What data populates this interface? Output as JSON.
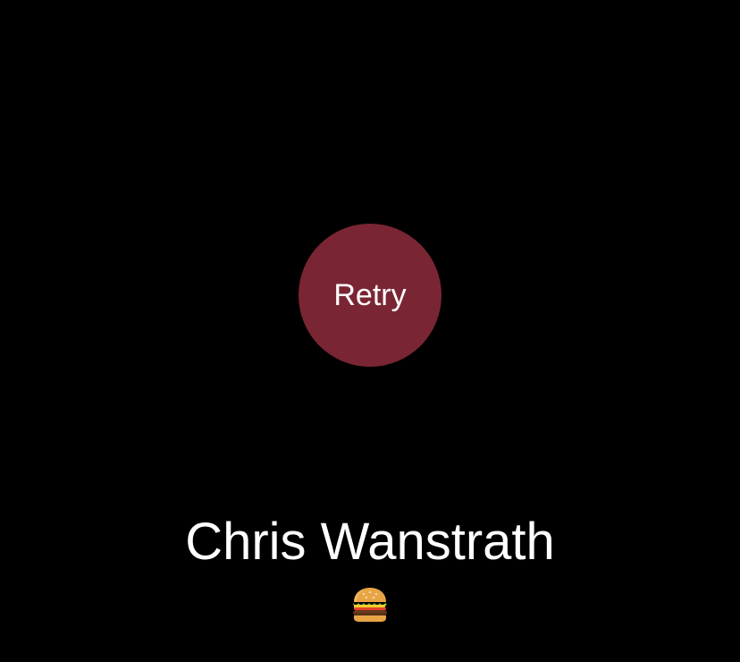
{
  "retry": {
    "label": "Retry",
    "color": "#7a2533"
  },
  "profile": {
    "name": "Chris Wanstrath",
    "status_icon": "hamburger-icon"
  },
  "colors": {
    "background": "#000000",
    "text": "#ffffff"
  }
}
